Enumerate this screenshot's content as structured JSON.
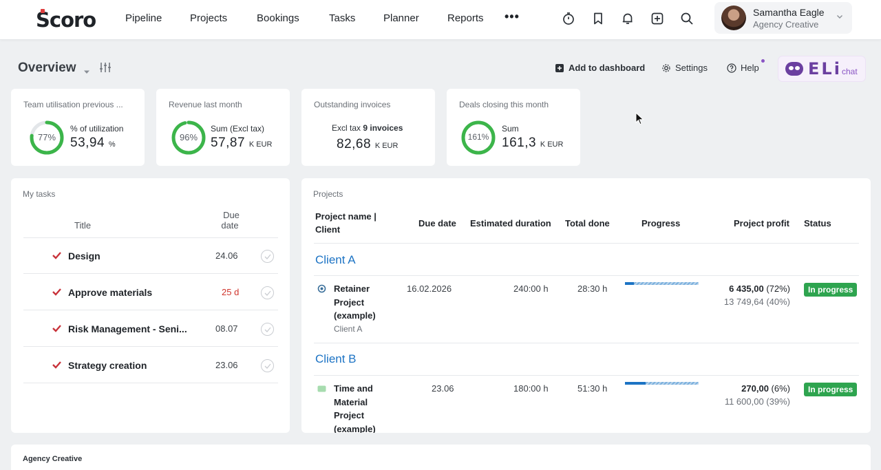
{
  "app": {
    "logo": "Scoro"
  },
  "nav": {
    "items": [
      "Pipeline",
      "Projects",
      "Bookings",
      "Tasks",
      "Planner",
      "Reports"
    ],
    "more": "•••"
  },
  "top_icons": [
    "timer-icon",
    "bookmark-icon",
    "bell-icon",
    "add-icon",
    "search-icon"
  ],
  "user": {
    "name": "Samantha Eagle",
    "role": "Agency Creative"
  },
  "overview": {
    "title": "Overview",
    "actions": {
      "add_dashboard": "Add to dashboard",
      "settings": "Settings",
      "help": "Help"
    },
    "eli": {
      "word": "ELi",
      "chat": "chat"
    }
  },
  "kpis": [
    {
      "label": "Team utilisation previous ...",
      "ring_text": "77%",
      "ring_value": 0.77,
      "sub": "% of utilization",
      "value": "53,94",
      "unit": "%"
    },
    {
      "label": "Revenue last month",
      "ring_text": "96%",
      "ring_value": 0.96,
      "sub": "Sum (Excl tax)",
      "value": "57,87",
      "unit": "K EUR"
    },
    {
      "label": "Outstanding invoices",
      "sub_prefix": "Excl tax",
      "sub_bold": "9 invoices",
      "value": "82,68",
      "unit": "K EUR"
    },
    {
      "label": "Deals closing this month",
      "ring_text": "161%",
      "ring_value": 1.0,
      "sub": "Sum",
      "value": "161,3",
      "unit": "K EUR"
    }
  ],
  "tasks": {
    "section": "My tasks",
    "col_title": "Title",
    "col_due1": "Due",
    "col_due2": "date",
    "rows": [
      {
        "title": "Design",
        "due": "24.06",
        "overdue": false
      },
      {
        "title": "Approve materials",
        "due": "25 d",
        "overdue": true
      },
      {
        "title": "Risk Management - Seni...",
        "due": "08.07",
        "overdue": false
      },
      {
        "title": "Strategy creation",
        "due": "23.06",
        "overdue": false
      }
    ]
  },
  "projects": {
    "section": "Projects",
    "headers": {
      "name1": "Project name |",
      "name2": "Client",
      "due": "Due date",
      "est": "Estimated duration",
      "done": "Total done",
      "progress": "Progress",
      "profit": "Project profit",
      "status": "Status"
    },
    "groups": [
      {
        "client": "Client A",
        "project": {
          "name_lines": [
            "Retainer",
            "Project",
            "(example)"
          ],
          "client": "Client A",
          "due": "16.02.2026",
          "estimated": "240:00 h",
          "done": "28:30 h",
          "progress": 0.12,
          "profit_bold": "6 435,00",
          "profit_pct": "(72%)",
          "profit2": "13 749,64 (40%)",
          "status": "In progress",
          "status_color": "#2ea44f"
        }
      },
      {
        "client": "Client B",
        "project": {
          "name_lines": [
            "Time and",
            "Material",
            "Project",
            "(example)"
          ],
          "client": "",
          "due": "23.06",
          "estimated": "180:00 h",
          "done": "51:30 h",
          "progress": 0.28,
          "profit_bold": "270,00",
          "profit_pct": "(6%)",
          "profit2": "11 600,00 (39%)",
          "status": "In progress",
          "status_color": "#2ea44f"
        }
      }
    ]
  },
  "bottom_section": "Agency Creative",
  "colors": {
    "accent_blue": "#1c73c4",
    "ring_green": "#3cb54a",
    "overdue_red": "#d0342c",
    "check_red": "#c8323a",
    "eli_purple": "#6b3fa0"
  }
}
